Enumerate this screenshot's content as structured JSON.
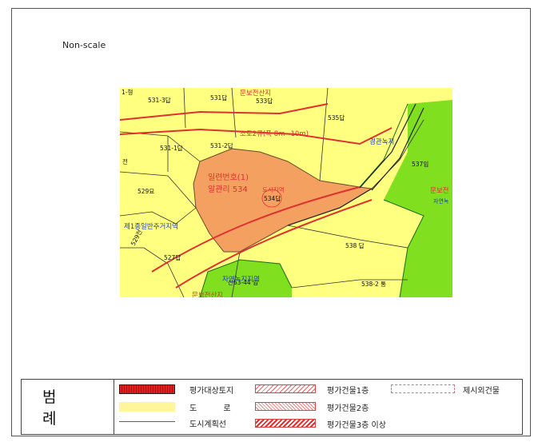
{
  "scale_note": "Non-scale",
  "map": {
    "parcels": [
      "1-형",
      "531-3답",
      "531답",
      "535답",
      "531-1답",
      "531-2답",
      "537임",
      "529묘",
      "전",
      "529전",
      "527답",
      "538 답",
      "538-2 통",
      "산63-44 임"
    ],
    "road": "소로2류(폭 8m~10m)",
    "subject_line1": "일련번호(1)",
    "subject_line2": "알관리 534",
    "subject_parcel": "534답",
    "zones": [
      "문보전산지",
      "533답",
      "경관녹지",
      "제1종일반주거지역",
      "자연녹지지역",
      "문보전",
      "자연녹",
      "도시지역",
      "문보전산지"
    ]
  },
  "legend": {
    "title": "범 례",
    "items": {
      "subject_land": "평가대상토지",
      "building_1f": "평가건물1층",
      "excluded_building": "제시외건물",
      "road": "도 로",
      "building_2f": "평가건물2층",
      "urban_plan_line": "도시계획선",
      "building_3f": "평가건물3층 이상"
    }
  },
  "colors": {
    "residential": "#ffff80",
    "green": "#80e020",
    "subject": "#f4a060",
    "road_line": "#e03030",
    "boundary": "#1a6a1a"
  }
}
